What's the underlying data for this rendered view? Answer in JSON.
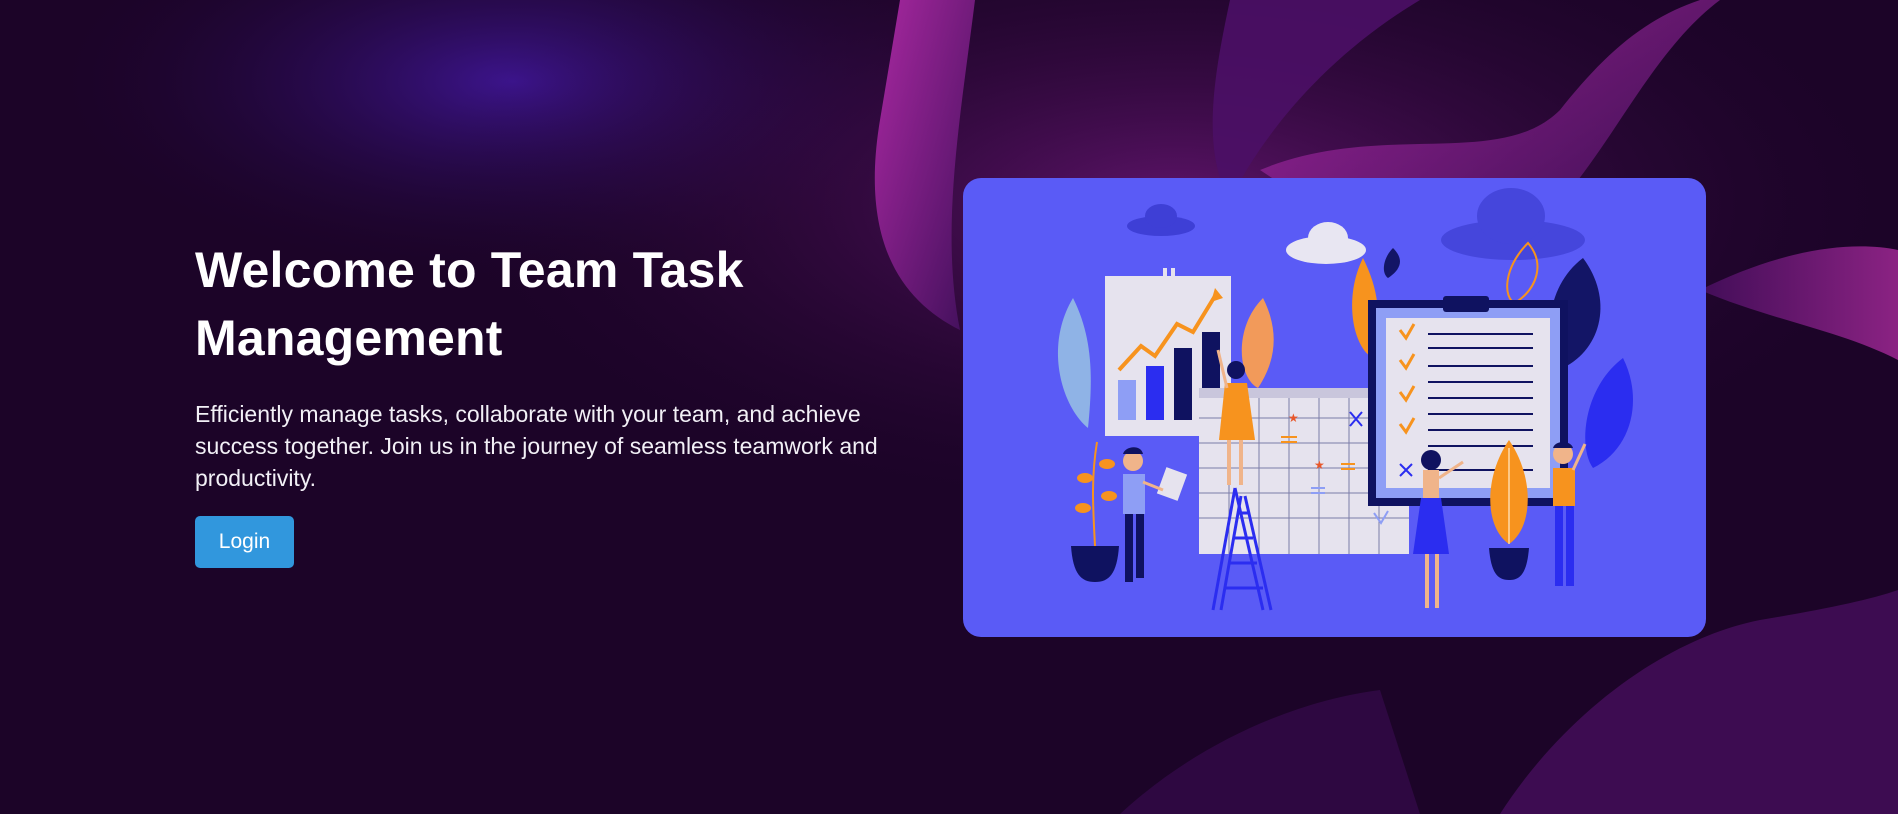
{
  "hero": {
    "title": "Welcome to Team Task Management",
    "subtitle": "Efficiently manage tasks, collaborate with your team, and achieve success together. Join us in the journey of seamless teamwork and productivity.",
    "login_label": "Login"
  },
  "illustration": {
    "name": "team-task-management-illustration",
    "colors": {
      "card": "#5a5bf6",
      "accent_orange": "#f7931e",
      "navy": "#0f1260",
      "paper": "#e6e3ee"
    }
  },
  "theme": {
    "background": "#1c0428",
    "button": "#3197dd"
  }
}
